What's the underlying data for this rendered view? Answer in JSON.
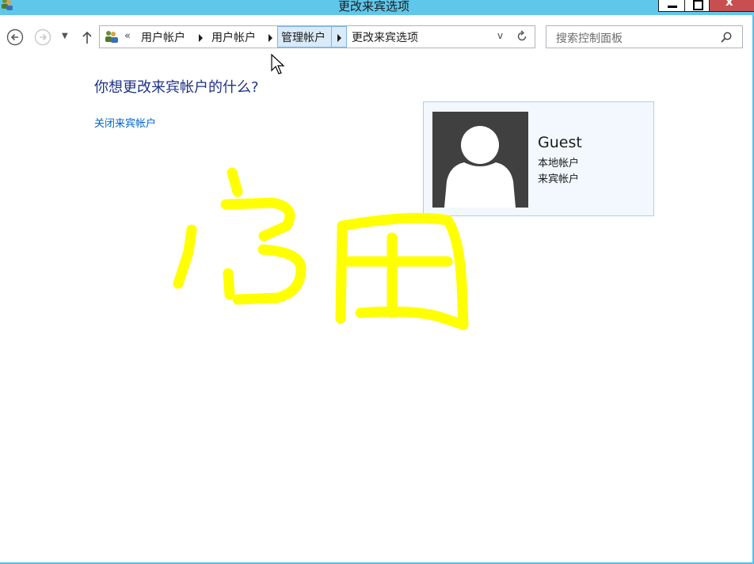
{
  "window": {
    "title": "更改来宾选项",
    "min_label": "",
    "close_label": "x"
  },
  "nav": {
    "back": "back",
    "forward": "forward"
  },
  "address": {
    "overflow": "«",
    "crumbs": [
      "用户帐户",
      "用户帐户",
      "管理帐户",
      "更改来宾选项"
    ],
    "dropdown": "v"
  },
  "search": {
    "placeholder": "搜索控制面板"
  },
  "main": {
    "heading": "你想更改来宾帐户的什么?",
    "tasks": [
      "关闭来宾帐户"
    ]
  },
  "account": {
    "name": "Guest",
    "type": "本地帐户",
    "kind": "来宾帐户"
  },
  "annotation": {
    "color": "#ffff00",
    "text": "启用"
  },
  "colors": {
    "titlebar": "#5fc7ea",
    "heading": "#1e3287",
    "link": "#0066cc",
    "card_bg": "#f2f8fe",
    "card_border": "#a9d0f1",
    "close_button": "#c74f4f"
  },
  "icons": {
    "app": "users-icon",
    "back": "back-arrow-icon",
    "forward": "forward-arrow-icon",
    "up": "up-arrow-icon",
    "refresh": "refresh-icon",
    "search": "search-icon",
    "avatar": "user-silhouette-icon"
  }
}
